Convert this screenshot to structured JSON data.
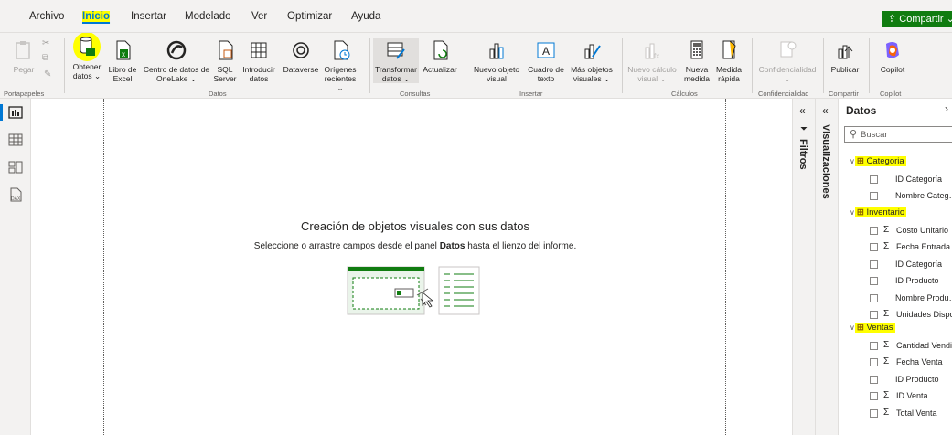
{
  "menubar": {
    "items": [
      "Archivo",
      "Inicio",
      "Insertar",
      "Modelado",
      "Ver",
      "Optimizar",
      "Ayuda"
    ],
    "active": "Inicio",
    "share_label": "Compartir"
  },
  "ribbon": {
    "portapapeles": {
      "pegar": "Pegar",
      "group": "Portapapeles"
    },
    "datos": {
      "obtener": [
        "Obtener",
        "datos ⌄"
      ],
      "excel": [
        "Libro de",
        "Excel"
      ],
      "onelake": [
        "Centro de datos de",
        "OneLake ⌄"
      ],
      "sql": [
        "SQL",
        "Server"
      ],
      "introducir": [
        "Introducir",
        "datos"
      ],
      "dataverse": "Dataverse",
      "origenes": [
        "Orígenes",
        "recientes ⌄"
      ],
      "group": "Datos"
    },
    "consultas": {
      "transformar": [
        "Transformar",
        "datos ⌄"
      ],
      "actualizar": "Actualizar",
      "group": "Consultas"
    },
    "insertar": {
      "nuevo_objeto": [
        "Nuevo objeto",
        "visual"
      ],
      "cuadro": [
        "Cuadro de",
        "texto"
      ],
      "mas": [
        "Más objetos",
        "visuales ⌄"
      ],
      "group": "Insertar"
    },
    "calculos": {
      "nuevo_calculo": [
        "Nuevo cálculo",
        "visual ⌄"
      ],
      "nueva_medida": [
        "Nueva",
        "medida"
      ],
      "medida_rapida": [
        "Medida",
        "rápida"
      ],
      "group": "Cálculos"
    },
    "confidencialidad": {
      "label": "Confidencialidad",
      "sub": "⌄",
      "group": "Confidencialidad"
    },
    "compartir": {
      "publicar": "Publicar",
      "group": "Compartir"
    },
    "copilot": {
      "label": "Copilot",
      "group": "Copilot"
    }
  },
  "canvas": {
    "heading": "Creación de objetos visuales con sus datos",
    "sub_before": "Seleccione o arrastre campos desde el panel ",
    "sub_bold": "Datos",
    "sub_after": " hasta el lienzo del informe."
  },
  "panes": {
    "filtros": "Filtros",
    "visualizaciones": "Visualizaciones",
    "collapse": "«"
  },
  "data_pane": {
    "title": "Datos",
    "search_placeholder": "Buscar",
    "tables": [
      {
        "name": "Categoria",
        "fields": [
          {
            "name": "ID Categoría",
            "sigma": false
          },
          {
            "name": "Nombre Categ…",
            "sigma": false
          }
        ]
      },
      {
        "name": "Inventario",
        "fields": [
          {
            "name": "Costo Unitario",
            "sigma": true
          },
          {
            "name": "Fecha Entrada",
            "sigma": true
          },
          {
            "name": "ID Categoría",
            "sigma": false
          },
          {
            "name": "ID Producto",
            "sigma": false
          },
          {
            "name": "Nombre Produ…",
            "sigma": false
          },
          {
            "name": "Unidades Dispo…",
            "sigma": true
          }
        ]
      },
      {
        "name": "Ventas",
        "fields": [
          {
            "name": "Cantidad Vendi…",
            "sigma": true
          },
          {
            "name": "Fecha Venta",
            "sigma": true
          },
          {
            "name": "ID Producto",
            "sigma": false
          },
          {
            "name": "ID Venta",
            "sigma": true
          },
          {
            "name": "Total Venta",
            "sigma": true
          }
        ]
      }
    ]
  },
  "colors": {
    "accent": "#0078d4",
    "share": "#107c10",
    "highlight": "#ffff00",
    "table_icon": "#8a6100"
  }
}
